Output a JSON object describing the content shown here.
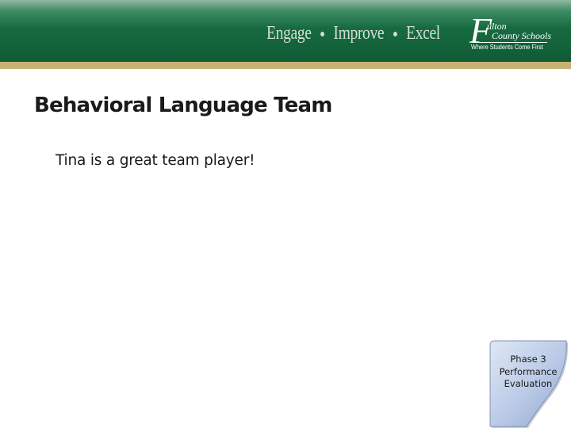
{
  "header": {
    "motto": [
      "Engage",
      "Improve",
      "Excel"
    ],
    "logo": {
      "initial": "F",
      "line1": "ulton",
      "line2": "County Schools",
      "tagline": "Where Students Come First"
    },
    "colors": {
      "banner": "#176b40",
      "stripe": "#c6b275"
    }
  },
  "slide": {
    "title": "Behavioral Language Team",
    "body": "Tina is a great team player!"
  },
  "badge": {
    "line1": "Phase 3",
    "line2": "Performance",
    "line3": "Evaluation",
    "color": "#b9c9e6"
  }
}
